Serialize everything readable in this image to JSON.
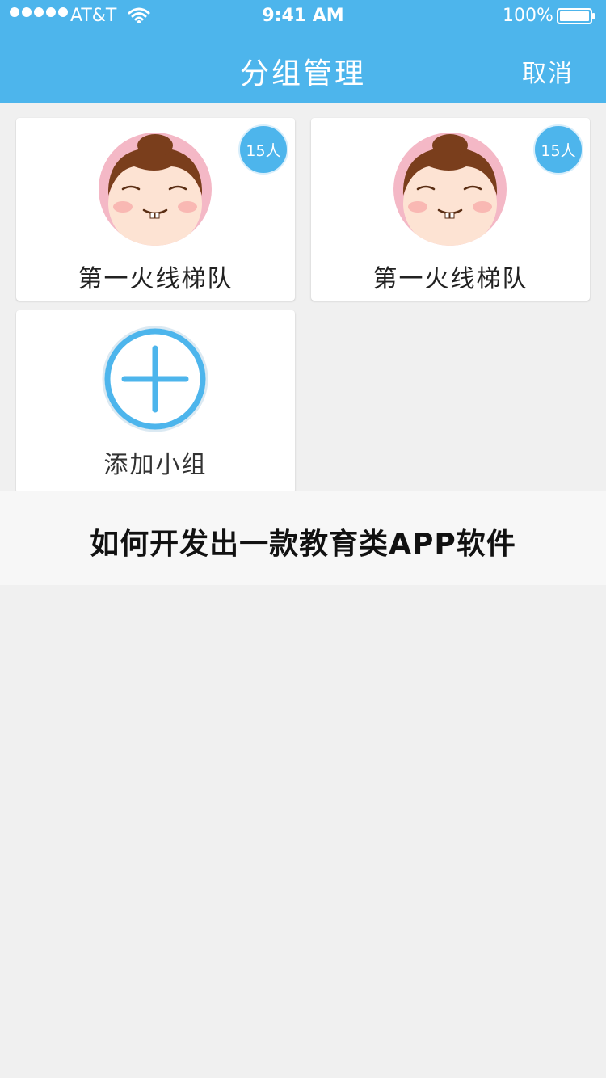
{
  "status_bar": {
    "carrier": "AT&T",
    "time": "9:41 AM",
    "battery": "100%"
  },
  "nav": {
    "title": "分组管理",
    "cancel": "取消"
  },
  "groups": [
    {
      "name": "第一火线梯队",
      "count": "15人"
    },
    {
      "name": "第一火线梯队",
      "count": "15人"
    }
  ],
  "add_group": {
    "label": "添加小组"
  },
  "banner": {
    "text": "如何开发出一款教育类APP软件"
  },
  "colors": {
    "accent": "#4db5ec",
    "background": "#f0f0f0"
  },
  "icons": [
    "signal-dots-icon",
    "wifi-icon",
    "battery-icon",
    "avatar-girl",
    "plus-circle-icon"
  ]
}
